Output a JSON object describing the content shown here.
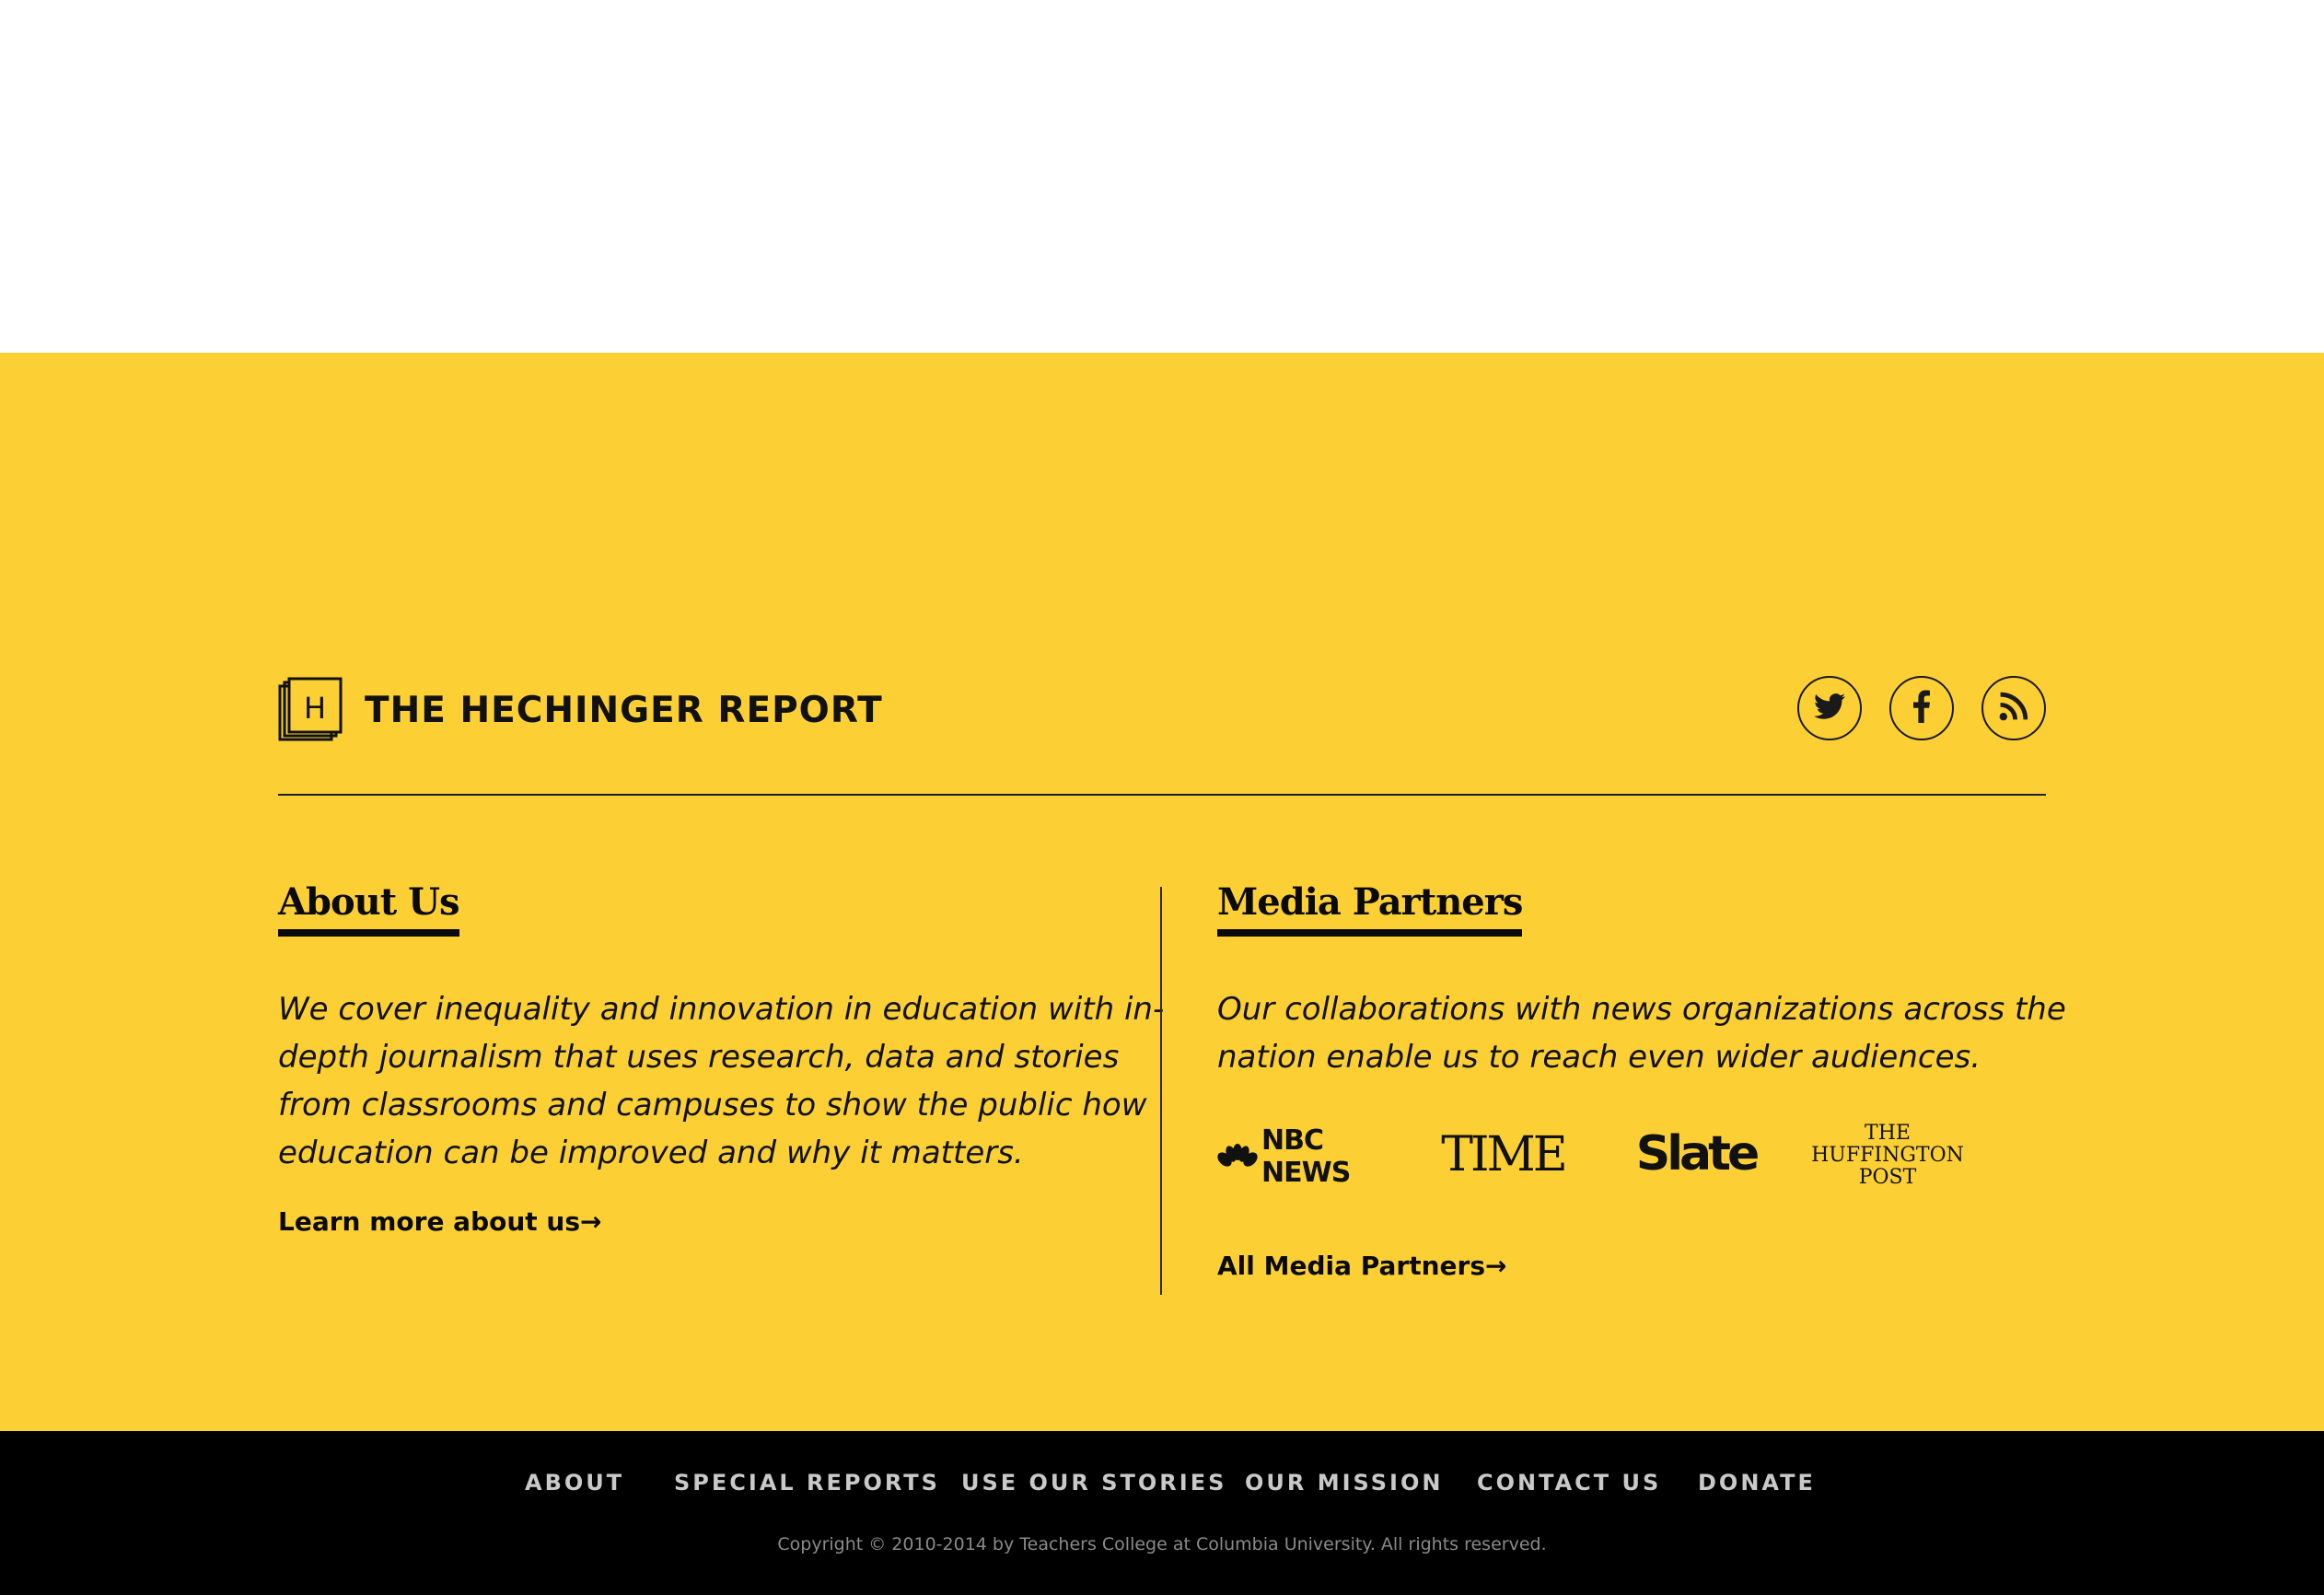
{
  "brand": {
    "name": "THE HECHINGER REPORT",
    "logo_letter": "H"
  },
  "social": [
    {
      "icon": "twitter-icon"
    },
    {
      "icon": "facebook-icon"
    },
    {
      "icon": "rss-icon"
    }
  ],
  "about": {
    "title": "About Us",
    "lines": [
      "We cover inequality and innovation in education with in-",
      "depth journalism that uses research, data and stories",
      "from classrooms and campuses to show the public how",
      "education can be improved and why it matters."
    ],
    "link": "Learn more about us",
    "arrow": "→"
  },
  "partners": {
    "title": "Media Partners",
    "lines": [
      "Our collaborations with news organizations across the",
      "nation enable us to reach even wider audiences."
    ],
    "logos": {
      "nbc": "NBC NEWS",
      "time": "TIME",
      "slate": "Slate",
      "huff": [
        "THE",
        "HUFFINGTON",
        "POST"
      ]
    },
    "link": "All Media Partners",
    "arrow": "→"
  },
  "footer": {
    "nav": [
      "ABOUT",
      "SPECIAL REPORTS",
      "USE OUR STORIES",
      "OUR MISSION",
      "CONTACT US",
      "DONATE"
    ],
    "copyright": "Copyright © 2010-2014 by Teachers College at Columbia University. All rights reserved."
  },
  "colors": {
    "yellow": "#fcd034",
    "footer_bg": "#000000",
    "text": "#111111"
  }
}
